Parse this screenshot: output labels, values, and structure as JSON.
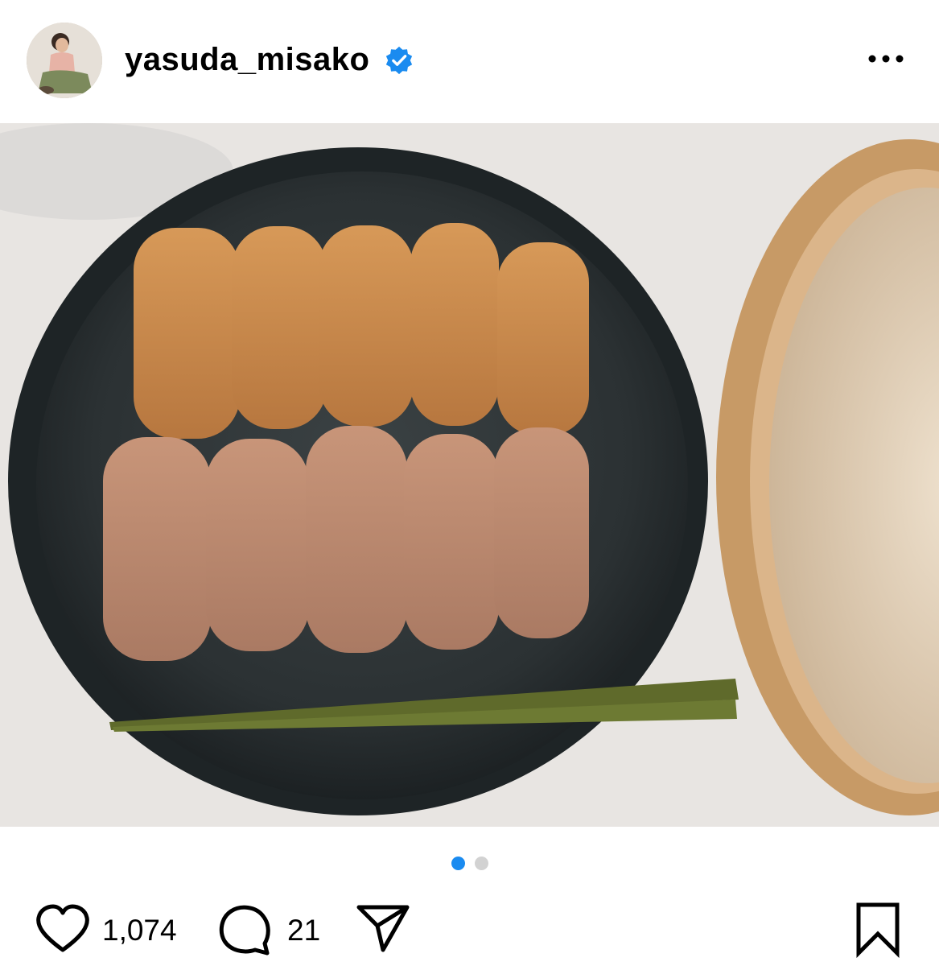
{
  "post": {
    "username": "yasuda_misako",
    "likes_count": "1,074",
    "comments_count": "21",
    "carousel": {
      "total": 2,
      "current": 1
    }
  },
  "icons": {
    "verified": "verified-badge-icon",
    "more": "more-options-icon",
    "like": "heart-icon",
    "comment": "comment-icon",
    "share": "share-icon",
    "save": "bookmark-icon"
  },
  "colors": {
    "verified": "#1a8bf0",
    "active_dot": "#1a8bf0",
    "inactive_dot": "#d2d2d2"
  }
}
